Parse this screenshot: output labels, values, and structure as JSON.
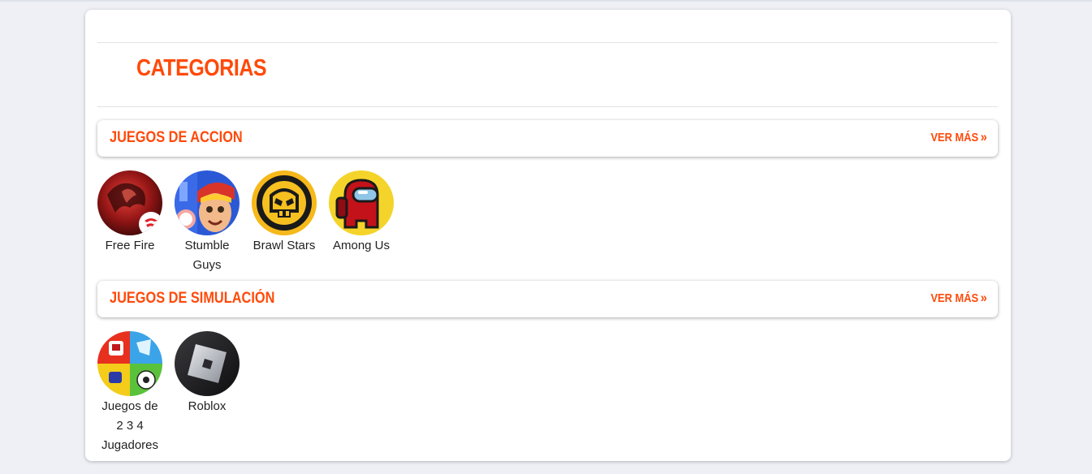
{
  "page": {
    "title": "CATEGORIAS"
  },
  "sections": [
    {
      "title": "JUEGOS DE ACCION",
      "see_more": "VER MÁS",
      "games": [
        {
          "name": "Free Fire",
          "icon": "free-fire-icon"
        },
        {
          "name": "Stumble Guys",
          "icon": "stumble-guys-icon"
        },
        {
          "name": "Brawl Stars",
          "icon": "brawl-stars-icon"
        },
        {
          "name": "Among Us",
          "icon": "among-us-icon"
        }
      ]
    },
    {
      "title": "JUEGOS DE SIMULACIÓN",
      "see_more": "VER MÁS",
      "games": [
        {
          "name": "Juegos de 2 3 4 Jugadores",
          "icon": "multiplayer-games-icon"
        },
        {
          "name": "Roblox",
          "icon": "roblox-icon"
        }
      ]
    }
  ],
  "colors": {
    "accent": "#ff4a0a",
    "background": "#eef0f5",
    "card": "#ffffff"
  }
}
